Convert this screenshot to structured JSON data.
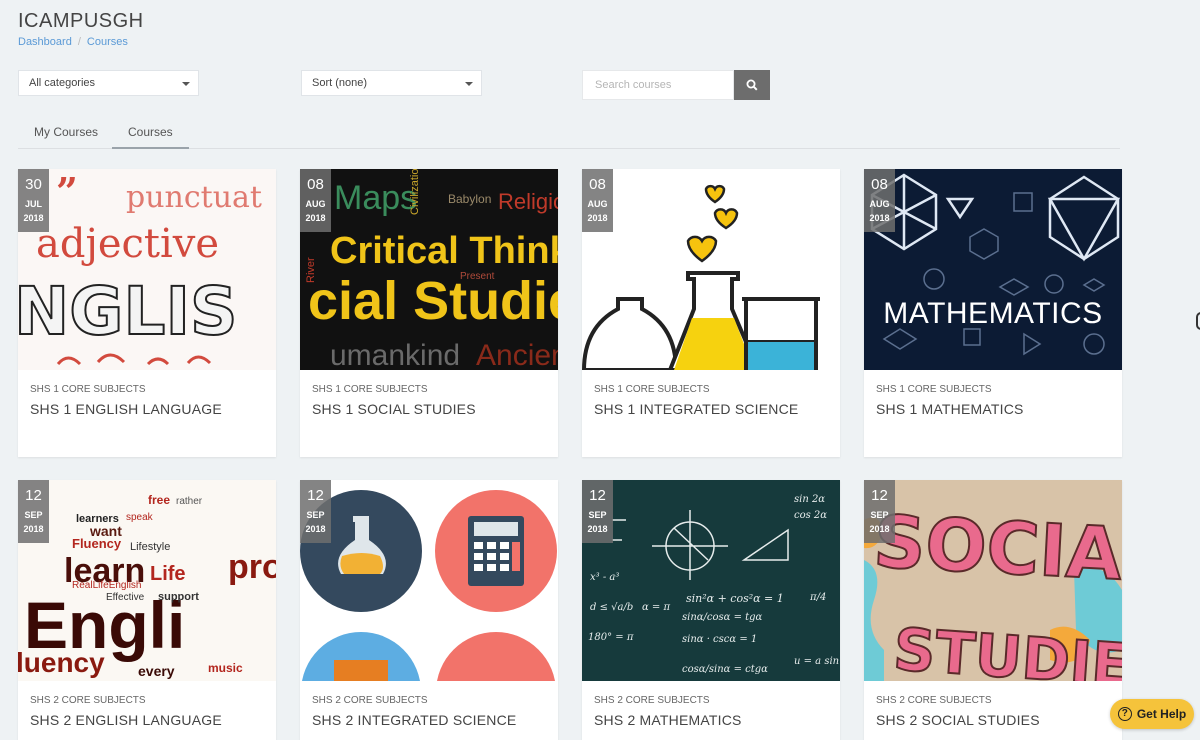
{
  "header": {
    "title": "ICAMPUSGH"
  },
  "breadcrumb": {
    "items": [
      "Dashboard",
      "Courses"
    ]
  },
  "filters": {
    "category": "All categories",
    "sort": "Sort (none)",
    "search_placeholder": "Search courses"
  },
  "tabs": [
    {
      "label": "My Courses",
      "active": false
    },
    {
      "label": "Courses",
      "active": true
    }
  ],
  "courses": [
    {
      "day": "30",
      "month": "JUL",
      "year": "2018",
      "category": "SHS 1 CORE SUBJECTS",
      "name": "SHS 1 ENGLISH LANGUAGE",
      "image_words": [
        "”",
        "punctuat",
        "adjective",
        "NGLIS"
      ]
    },
    {
      "day": "08",
      "month": "AUG",
      "year": "2018",
      "category": "SHS 1 CORE SUBJECTS",
      "name": "SHS 1 SOCIAL STUDIES",
      "image_words": [
        "Maps",
        "Civilization",
        "Babylon",
        "Religio",
        "Critical Thinkin",
        "River",
        "cial Studie",
        "Present",
        "umankind",
        "Ancien"
      ]
    },
    {
      "day": "08",
      "month": "AUG",
      "year": "2018",
      "category": "SHS 1 CORE SUBJECTS",
      "name": "SHS 1 INTEGRATED SCIENCE"
    },
    {
      "day": "08",
      "month": "AUG",
      "year": "2018",
      "category": "SHS 1 CORE SUBJECTS",
      "name": "SHS 1 MATHEMATICS",
      "image_words": [
        "MATHEMATICS"
      ]
    },
    {
      "day": "12",
      "month": "SEP",
      "year": "2018",
      "category": "SHS 2 CORE SUBJECTS",
      "name": "SHS 2 ENGLISH LANGUAGE",
      "image_words": [
        "free",
        "rather",
        "learners",
        "speak",
        "want",
        "Fluency",
        "Lifestyle",
        "learn",
        "Life",
        "pro",
        "Engli",
        "luency",
        "every",
        "music",
        "RealLifeEnglish",
        "support",
        "Effective"
      ]
    },
    {
      "day": "12",
      "month": "SEP",
      "year": "2018",
      "category": "SHS 2 CORE SUBJECTS",
      "name": "SHS 2 INTEGRATED SCIENCE"
    },
    {
      "day": "12",
      "month": "SEP",
      "year": "2018",
      "category": "SHS 2 CORE SUBJECTS",
      "name": "SHS 2 MATHEMATICS",
      "image_words": [
        "sin²α + cos²α = 1",
        "180° = π",
        "u = a sin",
        "sinα/cosα = tgα",
        "cosα/sinα = ctgα",
        "sinα · cscα = 1"
      ]
    },
    {
      "day": "12",
      "month": "SEP",
      "year": "2018",
      "category": "SHS 2 CORE SUBJECTS",
      "name": "SHS 2 SOCIAL STUDIES",
      "image_words": [
        "SOCIAL",
        "STUDIES"
      ]
    }
  ],
  "help": {
    "label": "Get Help"
  },
  "colors": {
    "accent_link": "#5b9ad6",
    "help_button": "#f5c33b",
    "date_badge": "#6e6e6e"
  }
}
